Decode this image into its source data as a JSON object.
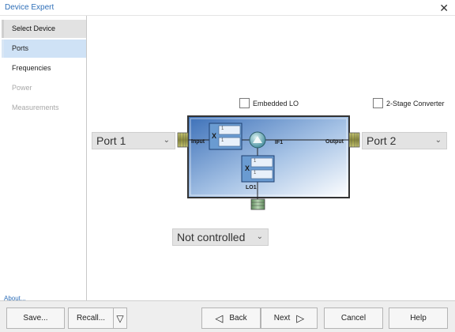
{
  "window": {
    "title": "Device Expert",
    "close_icon": "close-icon"
  },
  "sidebar": {
    "items": [
      {
        "label": "Select Device",
        "state": "active"
      },
      {
        "label": "Ports",
        "state": "selected"
      },
      {
        "label": "Frequencies",
        "state": "normal"
      },
      {
        "label": "Power",
        "state": "disabled"
      },
      {
        "label": "Measurements",
        "state": "disabled"
      }
    ]
  },
  "options": {
    "embedded_lo": {
      "label": "Embedded LO",
      "checked": false
    },
    "two_stage": {
      "label": "2-Stage Converter",
      "checked": false
    }
  },
  "ports": {
    "left": {
      "value": "Port 1"
    },
    "right": {
      "value": "Port 2"
    }
  },
  "lo_control": {
    "value": "Not controlled"
  },
  "diagram": {
    "input_label": "Input",
    "output_label": "Output",
    "if_label": "IF1",
    "lo_label": "LO1",
    "mixer_symbol": "X",
    "upper_box": [
      "1",
      "1"
    ],
    "lower_box": [
      "1",
      "1"
    ]
  },
  "about_link": "About...",
  "footer": {
    "save": "Save...",
    "recall": "Recall...",
    "back": "Back",
    "next": "Next",
    "cancel": "Cancel",
    "help": "Help"
  },
  "colors": {
    "accent": "#2f6fb8",
    "selected_bg": "#cfe2f6",
    "diagram_blue": "#3c70b8"
  }
}
